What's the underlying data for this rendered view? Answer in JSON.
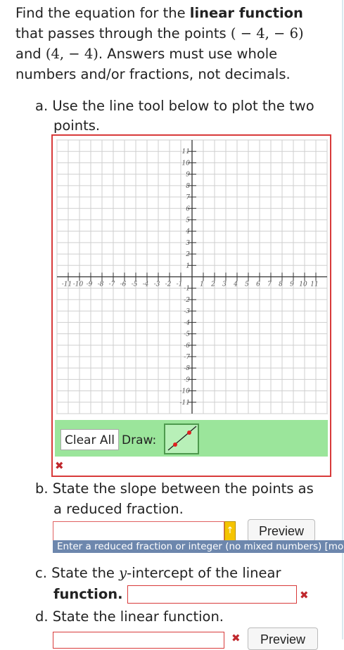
{
  "intro": {
    "line1_a": "Find the equation for the ",
    "line1_b": "linear function",
    "line2_a": "that passes through the points ",
    "point1": "( − 4,  − 6)",
    "line3_a": "and ",
    "point2": "(4,  − 4)",
    "line3_b": ". Answers must use whole",
    "line4": "numbers and/or fractions, not decimals."
  },
  "part_a": {
    "text_1": "a. Use the line tool below to plot the two",
    "text_2": "points."
  },
  "graph": {
    "x_ticks": [
      "-11",
      "-10",
      "-9",
      "-8",
      "-7",
      "-6",
      "-5",
      "-4",
      "-3",
      "-2",
      "-1",
      "1",
      "2",
      "3",
      "4",
      "5",
      "6",
      "7",
      "8",
      "9",
      "10",
      "11"
    ],
    "y_ticks": [
      "11",
      "10",
      "9",
      "8",
      "7",
      "6",
      "5",
      "4",
      "3",
      "2",
      "1",
      "-1",
      "-2",
      "-3",
      "-4",
      "-5",
      "-6",
      "-7",
      "-8",
      "-9",
      "-10",
      "-11"
    ],
    "range": [
      -11,
      11
    ]
  },
  "toolbar": {
    "clear_label": "Clear All",
    "draw_label": "Draw:",
    "tool_icon": "line-tool-icon"
  },
  "error_mark": "✖",
  "part_b": {
    "text_1": "b. State the slope between the points as",
    "text_2": "a reduced fraction.",
    "preview": "Preview",
    "hint": "Enter a reduced fraction or integer (no mixed numbers) [more..]"
  },
  "part_c": {
    "text_a": "c. State the ",
    "var": "y",
    "text_b": "-intercept of the linear",
    "text_c": "function."
  },
  "part_d": {
    "text": "d. State the linear function.",
    "preview": "Preview"
  },
  "colors": {
    "error_red": "#d83a3a",
    "toolbar_green": "#9be59b",
    "hint_blue": "#6d87ad",
    "warn_yellow": "#f5c400"
  }
}
